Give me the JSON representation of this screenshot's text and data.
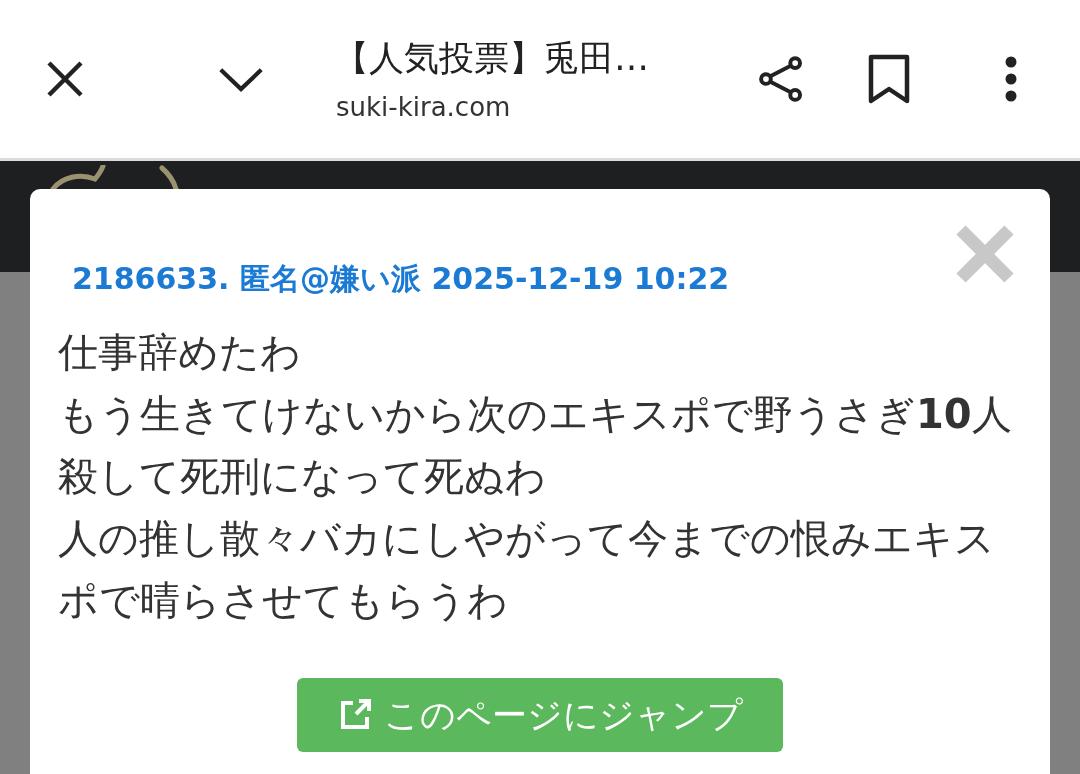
{
  "browser": {
    "title": "【人気投票】兎田…",
    "url": "suki-kira.com"
  },
  "popup": {
    "meta": "2186633. 匿名@嫌い派 2025-12-19 10:22",
    "lines": [
      "仕事辞めたわ",
      "もう生きてけないから次のエキスポで野うさぎ**10**人",
      "殺して死刑になって死ぬわ",
      "人の推し散々バカにしやがって今までの恨みエキス",
      "ポで晴らさせてもらうわ"
    ],
    "button": "このページにジャンプ"
  }
}
